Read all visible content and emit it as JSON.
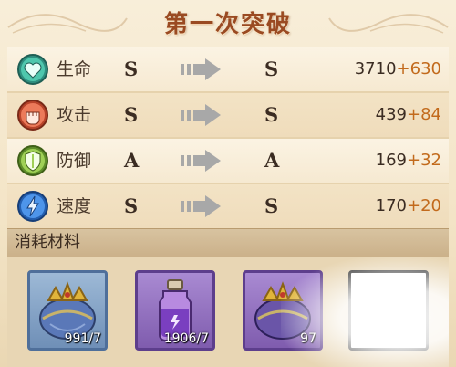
{
  "title": "第一次突破",
  "stats": [
    {
      "icon": "heart-icon",
      "label": "生命",
      "from": "S",
      "to": "S",
      "base": "3710",
      "bonus": "+630"
    },
    {
      "icon": "fist-icon",
      "label": "攻击",
      "from": "S",
      "to": "S",
      "base": "439",
      "bonus": "+84"
    },
    {
      "icon": "shield-icon",
      "label": "防御",
      "from": "A",
      "to": "A",
      "base": "169",
      "bonus": "+32"
    },
    {
      "icon": "lightning-icon",
      "label": "速度",
      "from": "S",
      "to": "S",
      "base": "170",
      "bonus": "+20"
    }
  ],
  "materials": {
    "title": "消耗材料",
    "items": [
      {
        "icon": "crown-icon",
        "rarity": "blue",
        "count": "991/7"
      },
      {
        "icon": "potion-bottle-icon",
        "rarity": "purple",
        "count": "1906/7"
      },
      {
        "icon": "crown-icon",
        "rarity": "purple",
        "count": "97"
      },
      {
        "icon": "empty-slot",
        "rarity": "empty",
        "count": ""
      }
    ]
  },
  "colors": {
    "title": "#9a4a22",
    "bonus": "#c26a1c",
    "life": "#3fb8a0",
    "attack": "#e06a4a",
    "defense": "#8bc34a",
    "speed": "#3a7fd8"
  }
}
